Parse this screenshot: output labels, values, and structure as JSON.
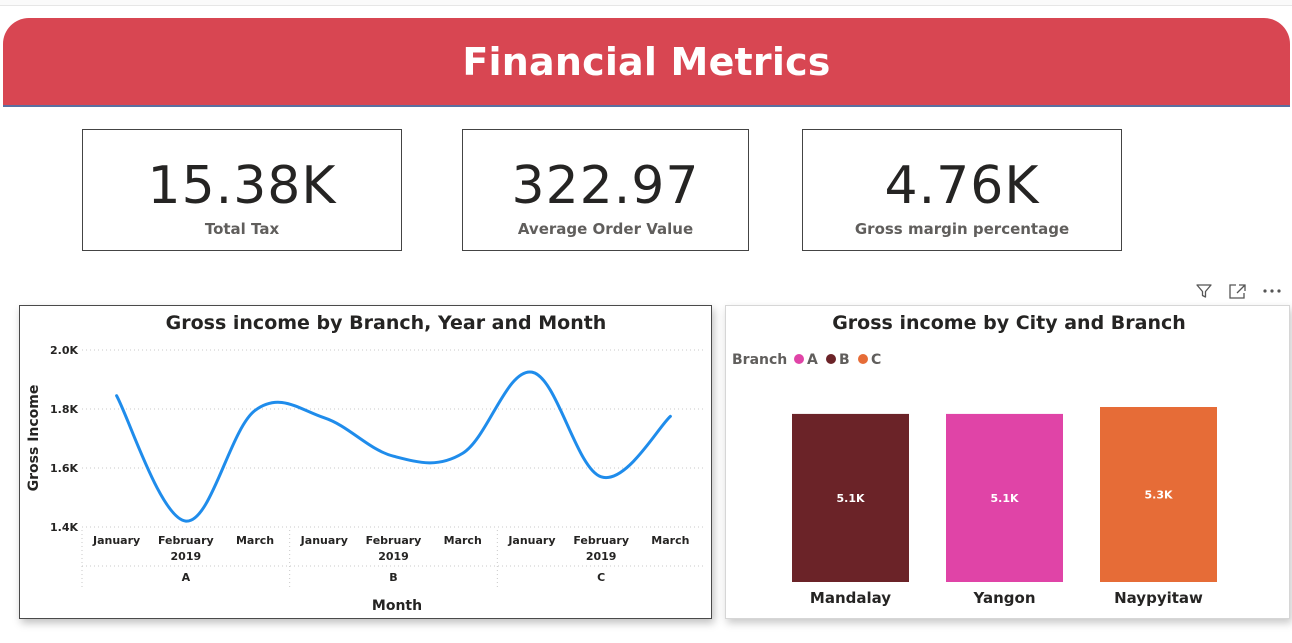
{
  "header": {
    "title": "Financial Metrics",
    "color": "#d84652"
  },
  "kpis": [
    {
      "value": "15.38K",
      "label": "Total Tax"
    },
    {
      "value": "322.97",
      "label": "Average Order Value"
    },
    {
      "value": "4.76K",
      "label": "Gross margin percentage"
    }
  ],
  "visual_header_icons": [
    "filter-icon",
    "focus-mode-icon",
    "more-options-icon"
  ],
  "chart_data": [
    {
      "type": "line",
      "title": "Gross income by Branch, Year and Month",
      "xlabel": "Month",
      "ylabel": "Gross Income",
      "ylim": [
        1400,
        2000
      ],
      "yticks": [
        "1.4K",
        "1.6K",
        "1.8K",
        "2.0K"
      ],
      "ytick_values": [
        1400,
        1600,
        1800,
        2000
      ],
      "grid": true,
      "color": "#1f8ceb",
      "x_groups": [
        {
          "branch": "A",
          "year": "2019",
          "months": [
            "January",
            "February",
            "March"
          ]
        },
        {
          "branch": "B",
          "year": "2019",
          "months": [
            "January",
            "February",
            "March"
          ]
        },
        {
          "branch": "C",
          "year": "2019",
          "months": [
            "January",
            "February",
            "March"
          ]
        }
      ],
      "series": [
        {
          "values": [
            1845,
            1420,
            1795,
            1770,
            1640,
            1650,
            1925,
            1570,
            1775
          ]
        }
      ]
    },
    {
      "type": "bar",
      "title": "Gross income by City and Branch",
      "legend_title": "Branch",
      "legend": [
        {
          "name": "A",
          "color": "#e044a7"
        },
        {
          "name": "B",
          "color": "#6b2328"
        },
        {
          "name": "C",
          "color": "#e66c37"
        }
      ],
      "legend_position": "top-left",
      "categories": [
        "Mandalay",
        "Yangon",
        "Naypyitaw"
      ],
      "branches": [
        "B",
        "A",
        "C"
      ],
      "values": [
        5057,
        5057,
        5265
      ],
      "data_labels": [
        "5.1K",
        "5.1K",
        "5.3K"
      ],
      "ylim": [
        0,
        5265
      ]
    }
  ]
}
